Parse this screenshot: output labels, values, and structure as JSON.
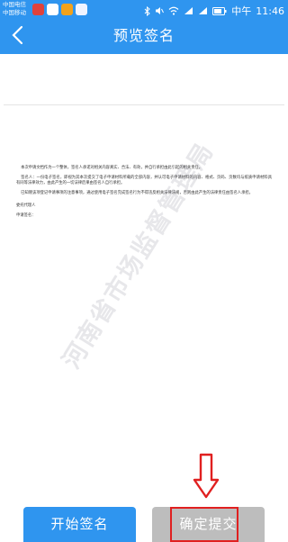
{
  "status_bar": {
    "carrier_1": "中国电信",
    "carrier_2": "中国移动",
    "network_label": "中午",
    "time": "11:46"
  },
  "nav": {
    "title": "预览签名"
  },
  "document": {
    "paragraphs": [
      "本次申请文档作为一个整体，签名人承诺对相关内容真实、合法、有效，并自行承担由此引起的相关责任。",
      "签名人：一份电子签名，即视为其本次提交了电子申请材料所载的全部内容，并认可电子申请材料的内容、格式、页码、页数均与纸质申请材料具有同等法律效力，由此产生的一切法律后果由签名人自行承担。",
      "已知晓该项登记申请事项的注意事项，通过使用电子签名完成签名行为不得违反相关法律法规，否则由此产生的法律责任由签名人承担。"
    ],
    "signature_labels": [
      "委托代理人",
      "申请签名："
    ],
    "watermark": "河南省市场监督管理局"
  },
  "buttons": {
    "start": "开始签名",
    "submit": "确定提交"
  },
  "colors": {
    "accent": "#2f95ef",
    "disabled": "#bdbdbd",
    "annotation": "#e02020"
  }
}
